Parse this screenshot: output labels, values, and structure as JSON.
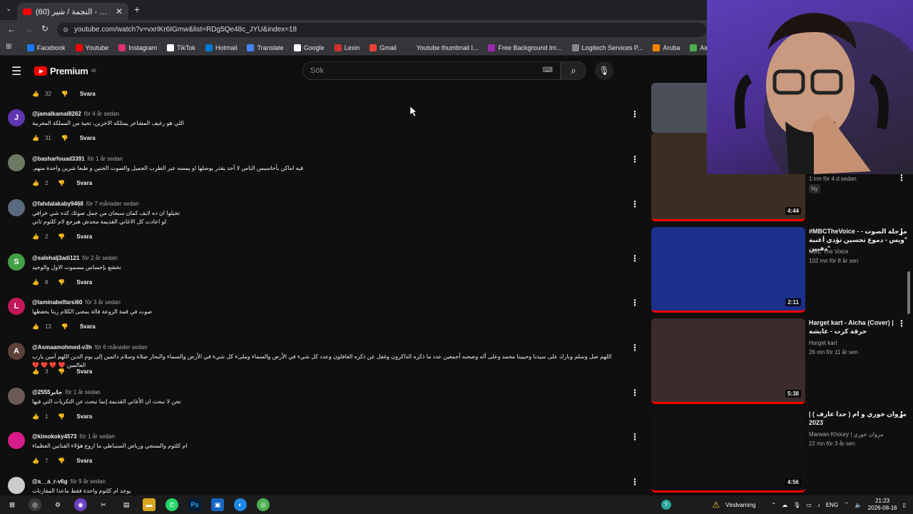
{
  "browser": {
    "tab_title": "(60) شيري ستوديو - النجمة / شير",
    "url": "youtube.com/watch?v=vxrIKr6IGmw&list=RDg5Qe48c_JYU&index=18",
    "bookmarks": [
      {
        "label": "Facebook",
        "color": "#1877f2"
      },
      {
        "label": "Youtube",
        "color": "#ff0000"
      },
      {
        "label": "Instagram",
        "color": "#e1306c"
      },
      {
        "label": "TikTok",
        "color": "#ffffff"
      },
      {
        "label": "Hotmail",
        "color": "#0078d4"
      },
      {
        "label": "Translate",
        "color": "#4285f4"
      },
      {
        "label": "Google",
        "color": "#ffffff"
      },
      {
        "label": "Lexin",
        "color": "#d32f2f"
      },
      {
        "label": "Gmail",
        "color": "#ea4335"
      },
      {
        "label": "Youtube thumbnail I...",
        "color": "#35363a"
      },
      {
        "label": "Free Background Im...",
        "color": "#9c27b0"
      },
      {
        "label": "Logitech Services P...",
        "color": "#888888"
      },
      {
        "label": "Aruba",
        "color": "#ff8300"
      },
      {
        "label": "AirWave",
        "color": "#4caf50"
      },
      {
        "label": "Smartsign Publ",
        "color": "#8bc34a"
      }
    ]
  },
  "header": {
    "logo_text": "Premium",
    "region": "SE",
    "search_placeholder": "Sök"
  },
  "top_comment_actions": {
    "likes": "32",
    "reply": "Svara"
  },
  "comments": [
    {
      "avatar_letter": "J",
      "avatar_color": "#5e35b1",
      "author": "@jamalkamal8262",
      "time": "för 4 år sedan",
      "text": "اللي هو رغيف المشاعر يمتلكه الاخرين، تحية من المملكة المغربية",
      "likes": "31",
      "reply": "Svara"
    },
    {
      "avatar_letter": "",
      "avatar_color": "#6d7a63",
      "author": "@basharfouad3391",
      "time": "för 1 år sedan",
      "text": "فيه اماكن بأحاسيس الناس لا أحد يقدر يوصلها او يمسه عبر الطرب الجميل والصوت الحنين و طبعا شرين واحدة منهم.",
      "likes": "2",
      "reply": "Svara"
    },
    {
      "avatar_letter": "",
      "avatar_color": "#5a6a80",
      "author": "@fahdalakaby9468",
      "time": "för 7 månader sedan",
      "text": "تخيلوا ان ده لايف كمان سبحان من جمل صوتك كده شي خرافي\nلو اعادت كل الاغاني القديمة محدش هيرجع لام كلثوم تاني",
      "likes": "2",
      "reply": "Svara"
    },
    {
      "avatar_letter": "S",
      "avatar_color": "#43a047",
      "author": "@salehalj3adi121",
      "time": "för 2 år sedan",
      "text": "تخشع بإحساس مسموت الاول والوحيد",
      "likes": "8",
      "reply": "Svara"
    },
    {
      "avatar_letter": "L",
      "avatar_color": "#c2185b",
      "author": "@laminabelfarsi60",
      "time": "för 3 år sedan",
      "text": "صوت في قمة الروعة فالة بمعنى الكلام ربنا يحفظها",
      "likes": "13",
      "reply": "Svara"
    },
    {
      "avatar_letter": "A",
      "avatar_color": "#5d4037",
      "author": "@Asmaamohmed-v3h",
      "time": "för 6 månader sedan",
      "text": "اللهم صل وسلم وبارك على سيدنا وحبيبنا محمد وعلى آله وصحبه أجمعين عدد ما ذكره الذاكرون وغفل عن ذكره الغافلون وعدد كل شيء في الأرض والسماء وملىء كل شيء في الأرض والسماء والبحار صلاة وسلام دائمين إلى يوم الدين اللهم آمين يارب العالمين ❤️ ❤️ ❤️ ❤️",
      "likes": "3",
      "reply": "Svara"
    },
    {
      "avatar_letter": "",
      "avatar_color": "#6b5a55",
      "author": "@2555جابر",
      "time": "för 1 år sedan",
      "text": "نحن لا نبحث ان الأغاني القديمة إنما نبحث عن التكريات التي فيها",
      "likes": "1",
      "reply": "Svara"
    },
    {
      "avatar_letter": "",
      "avatar_color": "#d81b8a",
      "author": "@kimokoky4573",
      "time": "för 1 år sedan",
      "text": "ام كلثوم والسنجي ورياض السنباطي ما اروع هؤلاء الفنانين العظماء",
      "likes": "7",
      "reply": "Svara"
    },
    {
      "avatar_letter": "",
      "avatar_color": "#cccccc",
      "author": "@a__a_r-v6g",
      "time": "för 9 år sedan",
      "text": "يوجد ام كلثوم واحدة فقط ماعدا المقارنات",
      "likes": "",
      "reply": ""
    }
  ],
  "sidebar_videos": [
    {
      "title": "",
      "channel": "",
      "meta": "1 mn  för 4 d sedan",
      "badge": "Ny",
      "duration": "4:44",
      "thumb_color": "#3a2e22"
    },
    {
      "title": "#MBCTheVoice - مرحلة الصوت - \"ويس - دموع تحسين تؤدي أغنية \"دفيين",
      "channel": "MBC The Voice",
      "meta": "102 mn  för 8 år sen",
      "badge": "",
      "duration": "2:11",
      "thumb_color": "#1c2f8a"
    },
    {
      "title": "Harget kart - Aicha (Cover) | حرقة كرت - عايشة",
      "channel": "Harget kart",
      "meta": "26 mn  för 11 år sen",
      "badge": "",
      "duration": "5:38",
      "thumb_color": "#3b2b2b"
    },
    {
      "title": "مروان خوري و ام ( حدا عارف ) | 2023",
      "channel": "Marwan Khoury | مروان خوري",
      "meta": "22 mn  för 3 år sen",
      "badge": "",
      "duration": "4:56",
      "thumb_color": "#111111"
    }
  ],
  "taskbar": {
    "warning_label": "Vindvarning",
    "language": "ENG",
    "time": "21:23",
    "date": "2026-08-16"
  }
}
